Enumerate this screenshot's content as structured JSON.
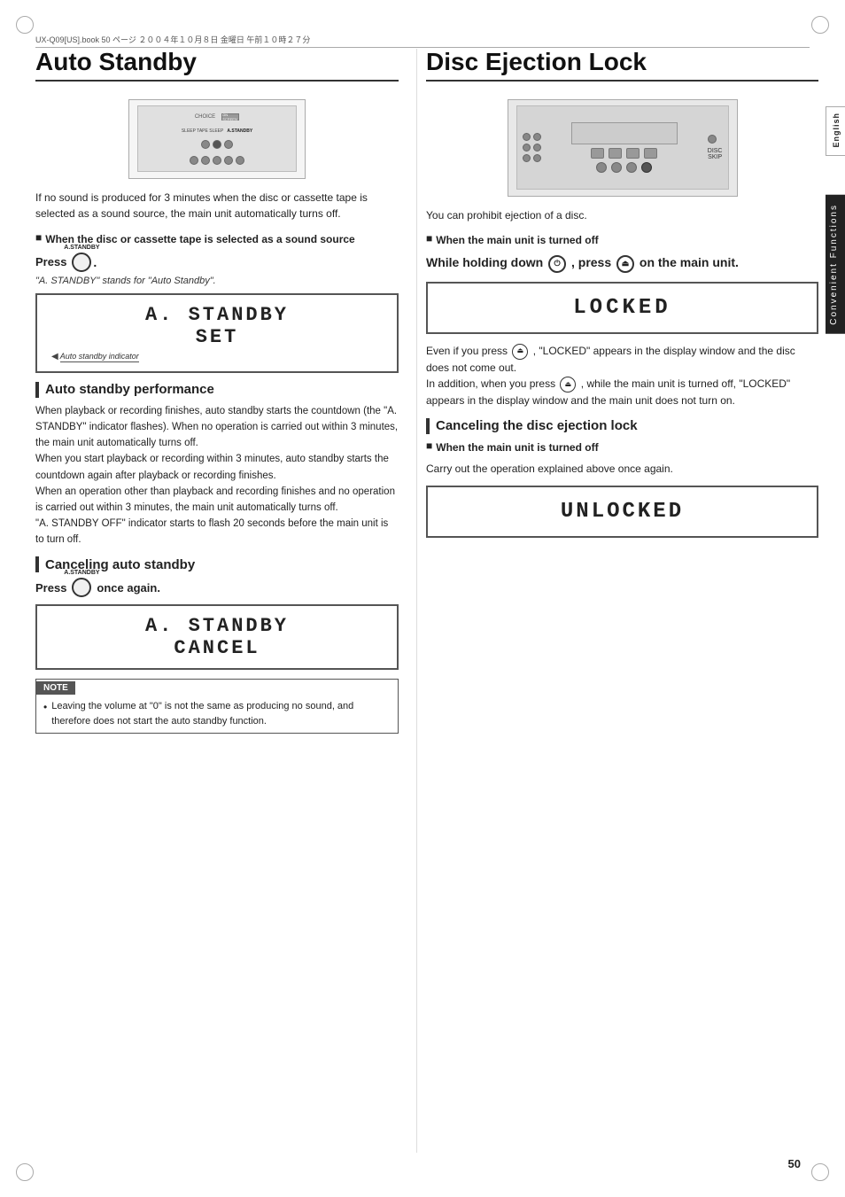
{
  "page": {
    "number": "50",
    "header_text": "UX-Q09[US].book  50 ページ  ２００４年１０月８日  金曜日  午前１０時２７分"
  },
  "sidebar": {
    "lang_label": "English",
    "section_label": "Convenient Functions"
  },
  "left": {
    "title": "Auto Standby",
    "body1": "If no sound is produced for 3 minutes when the disc or cassette tape is selected as a sound source, the main unit automatically turns off.",
    "bullet1": "When the disc or cassette tape is selected as a sound source",
    "press_label": "Press",
    "press_period": ".",
    "btn_label": "A.STANDBY",
    "standby_quote": "\"A. STANDBY\" stands for \"Auto Standby\".",
    "display_set_line1": "A. STANDBY",
    "display_set_line2": "SET",
    "indicator_text": "Auto standby indicator",
    "sub1_title": "Auto standby performance",
    "long_body": "When playback or recording finishes, auto standby starts the countdown (the \"A. STANDBY\" indicator flashes). When no operation is carried out within 3 minutes, the main unit automatically turns off.\nWhen you start playback or recording within 3 minutes, auto standby starts the countdown again after playback or recording finishes.\nWhen an operation other than playback and recording finishes and no operation is carried out within 3 minutes, the main unit automatically turns off.\n\"A. STANDBY OFF\" indicator starts to flash 20 seconds before the main unit is to turn off.",
    "sub2_title": "Canceling auto standby",
    "cancel_press_label": "Press",
    "cancel_press_suffix": "once again.",
    "cancel_btn_label": "A.STANDBY",
    "display_cancel_line1": "A. STANDBY",
    "display_cancel_line2": "CANCEL",
    "note_header": "NOTE",
    "note_text": "Leaving the volume at \"0\" is not the same as producing no sound, and therefore does not start the auto standby function."
  },
  "right": {
    "title": "Disc Ejection Lock",
    "body1": "You can prohibit ejection of a disc.",
    "bullet1": "When the main unit is turned off",
    "instruction": "While holding down",
    "instruction2": ", press",
    "instruction3": "on the main unit.",
    "icon1_label": "power",
    "icon2_label": "eject",
    "locked_text": "LOCKED",
    "locked_body1": "Even if you press",
    "locked_body2": ", \"LOCKED\" appears in the display window and the disc does not come out.",
    "locked_body3": "In addition, when you press",
    "locked_body4": ", while the main unit is turned off, \"LOCKED\" appears in the display window and the main unit does not turn on.",
    "sub1_title": "Canceling the disc ejection lock",
    "bullet2": "When the main unit is turned off",
    "cancel_body": "Carry out the operation explained above once again.",
    "unlocked_text": "UNLOCKED"
  }
}
